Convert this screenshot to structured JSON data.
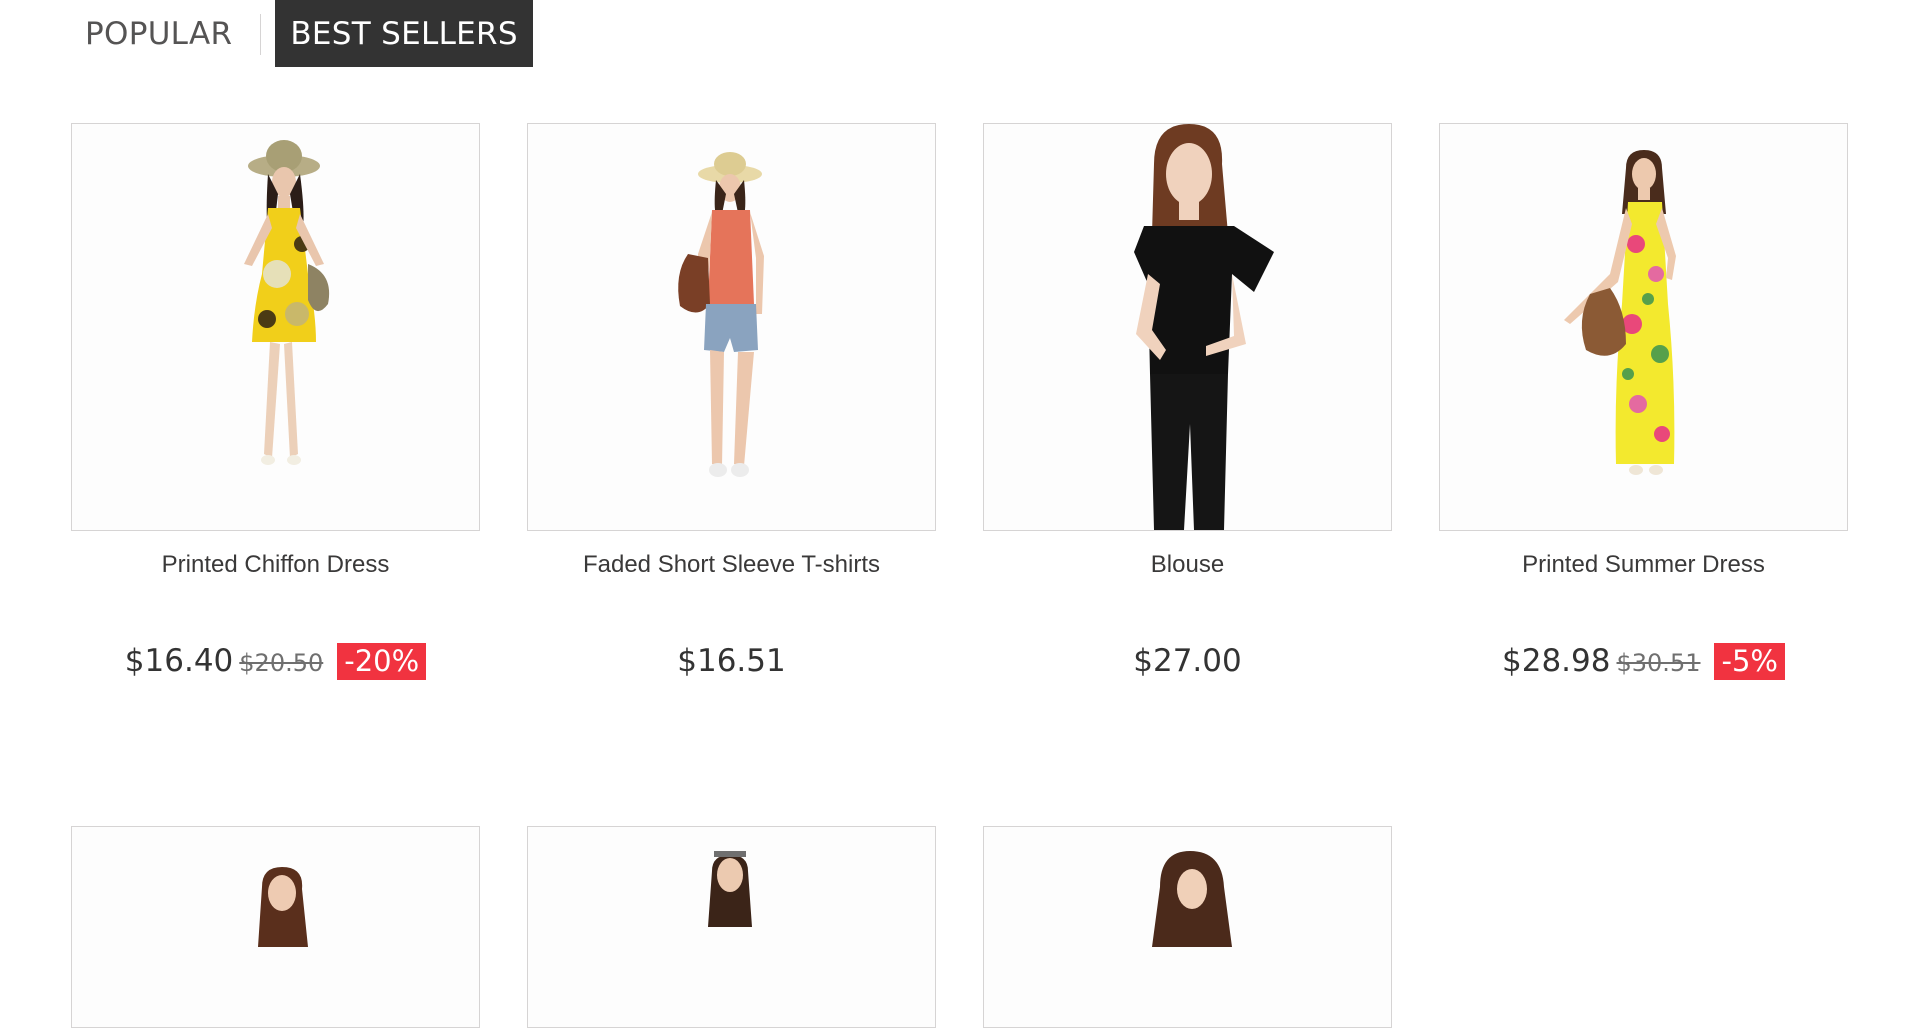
{
  "tabs": [
    {
      "label": "Popular",
      "active": false
    },
    {
      "label": "Best Sellers",
      "active": true
    }
  ],
  "products": [
    {
      "name": "Printed Chiffon Dress",
      "price": "$16.40",
      "old_price": "$20.50",
      "reduction": "-20%",
      "image": "woman-yellow-chiffon-dress"
    },
    {
      "name": "Faded Short Sleeve T-shirts",
      "price": "$16.51",
      "old_price": "",
      "reduction": "",
      "image": "woman-orange-tshirt-denim-shorts"
    },
    {
      "name": "Blouse",
      "price": "$27.00",
      "old_price": "",
      "reduction": "",
      "image": "woman-black-blouse"
    },
    {
      "name": "Printed Summer Dress",
      "price": "$28.98",
      "old_price": "$30.51",
      "reduction": "-5%",
      "image": "woman-yellow-floral-maxi-dress"
    },
    {
      "image": "woman-product-partial"
    },
    {
      "image": "woman-product-partial"
    },
    {
      "image": "woman-product-partial"
    }
  ],
  "colors": {
    "accent_dark": "#333333",
    "sale_red": "#f13340",
    "border": "#d6d4d4"
  }
}
